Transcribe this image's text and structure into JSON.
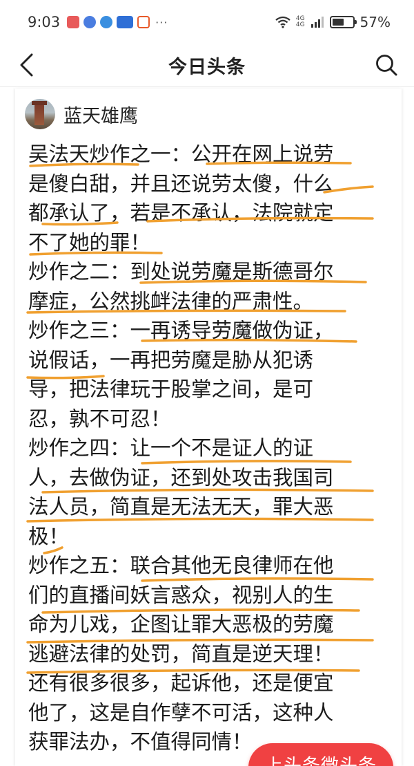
{
  "status_bar": {
    "time": "9:03",
    "dots": "···",
    "net_label_top": "4G",
    "net_label_bottom": "4G",
    "battery_percent": 57,
    "battery_text": "57%"
  },
  "nav": {
    "title": "今日头条",
    "back_icon": "chevron-left-icon",
    "search_icon": "search-icon"
  },
  "author": {
    "name": "蓝天雄鹰"
  },
  "article": {
    "lines": [
      "吴法天炒作之一：公开在网上说劳",
      "是傻白甜，并且还说劳太傻，什么",
      "都承认了，若是不承认，法院就定",
      "不了她的罪！",
      "炒作之二：到处说劳魔是斯德哥尔",
      "摩症，公然挑衅法律的严肃性。",
      "炒作之三：一再诱导劳魔做伪证，",
      "说假话，一再把劳魔是胁从犯诱",
      "导，把法律玩于股掌之间，是可",
      "忍，孰不可忍！",
      "炒作之四：让一个不是证人的证",
      "人，去做伪证，还到处攻击我国司",
      "法人员，简直是无法无天，罪大恶",
      "极！",
      "炒作之五：联合其他无良律师在他",
      "们的直播间妖言惑众，视别人的生",
      "命为儿戏，企图让罪大恶极的劳魔",
      "逃避法律的处罚，简直是逆天理！",
      "还有很多很多，起诉他，还是便宜",
      "他了，这是自作孽不可活，这种人",
      "获罪法办，不值得同情！"
    ]
  },
  "float_button": {
    "label": "上头条微头条"
  },
  "colors": {
    "accent_red": "#f04142",
    "underline_orange": "#f0a030"
  }
}
